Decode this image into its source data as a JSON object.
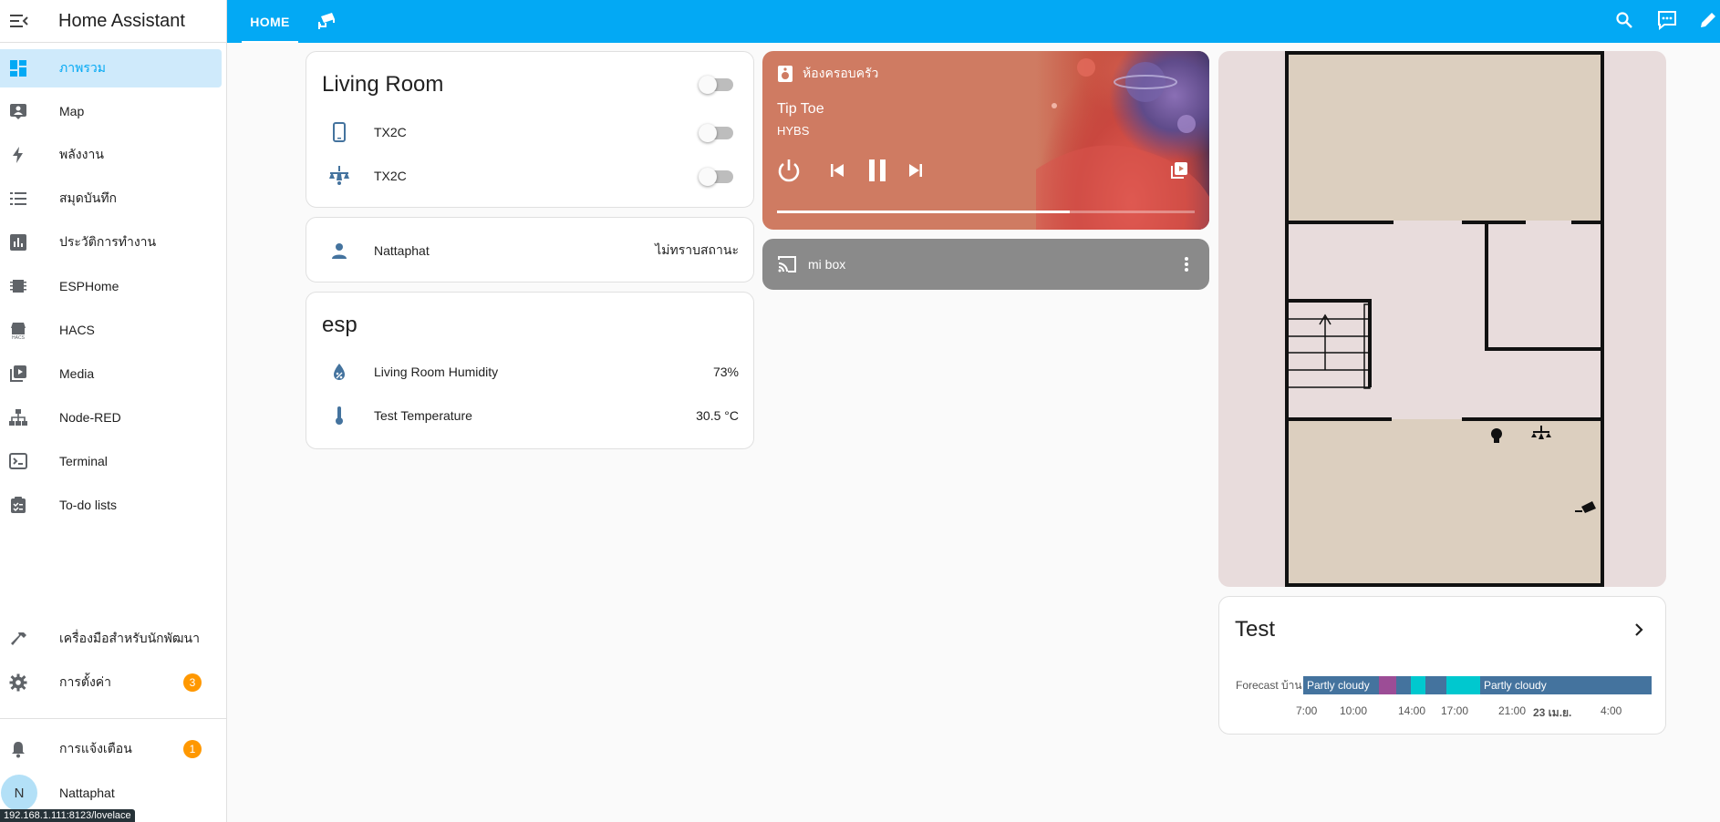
{
  "app": {
    "title": "Home Assistant"
  },
  "sidebar": {
    "items": [
      {
        "label": "ภาพรวม",
        "icon": "dashboard-icon",
        "active": true
      },
      {
        "label": "Map",
        "icon": "map-icon"
      },
      {
        "label": "พลังงาน",
        "icon": "lightning-icon"
      },
      {
        "label": "สมุดบันทึก",
        "icon": "logbook-icon"
      },
      {
        "label": "ประวัติการทำงาน",
        "icon": "history-chart-icon"
      },
      {
        "label": "ESPHome",
        "icon": "chip-icon"
      },
      {
        "label": "HACS",
        "icon": "hacs-icon"
      },
      {
        "label": "Media",
        "icon": "media-icon"
      },
      {
        "label": "Node-RED",
        "icon": "sitemap-icon"
      },
      {
        "label": "Terminal",
        "icon": "terminal-icon"
      },
      {
        "label": "To-do lists",
        "icon": "todo-icon"
      }
    ],
    "developer_tools": "เครื่องมือสำหรับนักพัฒนา",
    "settings": {
      "label": "การตั้งค่า",
      "badge": "3"
    },
    "notifications": {
      "label": "การแจ้งเตือน",
      "badge": "1"
    },
    "user": {
      "name": "Nattaphat",
      "initial": "N"
    },
    "url_tooltip": "192.168.1.111:8123/lovelace"
  },
  "topbar": {
    "tab_home": "HOME"
  },
  "living_room": {
    "title": "Living Room",
    "rows": [
      {
        "name": "TX2C",
        "icon": "phone-icon"
      },
      {
        "name": "TX2C",
        "icon": "ceiling-light-icon"
      }
    ]
  },
  "person": {
    "name": "Nattaphat",
    "state": "ไม่ทราบสถานะ"
  },
  "esp": {
    "title": "esp",
    "rows": [
      {
        "name": "Living Room Humidity",
        "value": "73%"
      },
      {
        "name": "Test Temperature",
        "value": "30.5 °C"
      }
    ]
  },
  "media": {
    "source": "ห้องครอบครัว",
    "title": "Tip Toe",
    "artist": "HYBS",
    "progress": 0.7
  },
  "mibox": {
    "name": "mi box"
  },
  "weather": {
    "title": "Test",
    "label": "Forecast บ้าน",
    "segments_text": [
      "Partly cloudy",
      "Partly cloudy"
    ],
    "ticks": [
      "7:00",
      "10:00",
      "14:00",
      "17:00",
      "21:00",
      "23 เม.ย.",
      "4:00"
    ],
    "colors": {
      "cloudy": "#44739e",
      "rainy": "#9c4d96",
      "clear_night": "#00c8cf"
    }
  }
}
